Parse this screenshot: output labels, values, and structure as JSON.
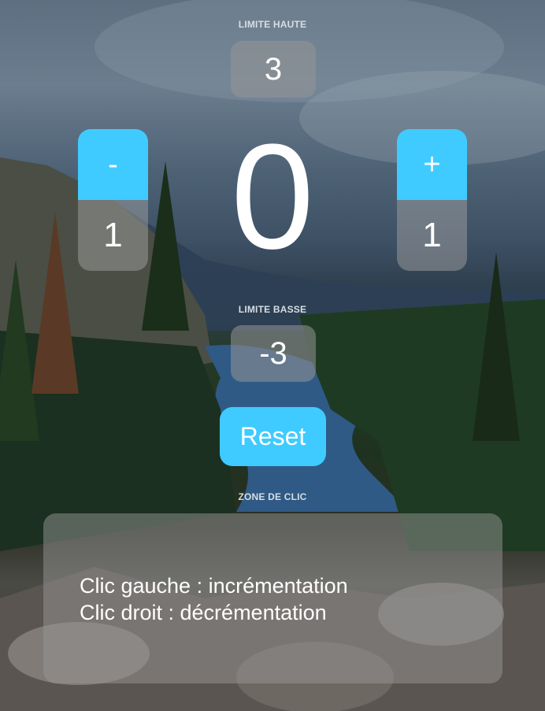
{
  "upper_limit": {
    "label": "LIMITE HAUTE",
    "value": "3"
  },
  "counter": {
    "value": "0"
  },
  "decrement": {
    "label": "-",
    "step": "1"
  },
  "increment": {
    "label": "+",
    "step": "1"
  },
  "lower_limit": {
    "label": "LIMITE BASSE",
    "value": "-3"
  },
  "reset": {
    "label": "Reset"
  },
  "click_zone": {
    "label": "ZONE DE CLIC",
    "line1": "Clic gauche : incrémentation",
    "line2": "Clic droit : décrémentation"
  },
  "colors": {
    "accent": "#3fcbff",
    "panel": "rgba(150,150,150,0.55)"
  }
}
